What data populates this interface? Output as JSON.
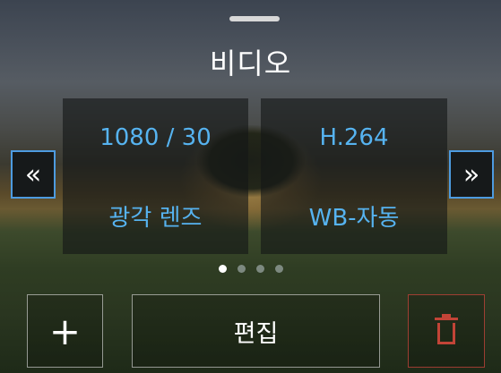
{
  "header": {
    "title": "비디오"
  },
  "settings": {
    "resolution": "1080 / 30",
    "codec": "H.264",
    "lens": "광각 렌즈",
    "white_balance": "WB-자동"
  },
  "nav": {
    "prev_glyph": "«",
    "next_glyph": "»"
  },
  "pager": {
    "total": 4,
    "active": 1
  },
  "actions": {
    "add_glyph": "+",
    "edit_label": "편집",
    "delete_icon": "trash-icon"
  },
  "colors": {
    "accent": "#56b3f0",
    "highlight_border": "#4d9be0",
    "danger": "#c24437"
  }
}
